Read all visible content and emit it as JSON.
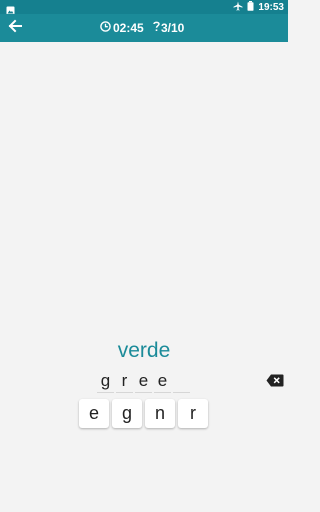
{
  "status_bar": {
    "time": "19:53",
    "left_icon": "image-notification-icon",
    "icons": [
      "airplane-icon",
      "battery-icon"
    ]
  },
  "app_bar": {
    "back_icon": "arrow-left-icon",
    "timer_icon": "clock-icon",
    "timer": "02:45",
    "progress_icon": "question-icon",
    "progress": "3/10"
  },
  "quiz": {
    "word": "verde",
    "answer_slots": [
      "g",
      "r",
      "e",
      "e",
      ""
    ],
    "letter_keys": [
      "e",
      "g",
      "n",
      "r"
    ],
    "backspace_icon": "backspace-icon"
  },
  "colors": {
    "accent": "#1b8b99",
    "status_bar": "#15808f",
    "background": "#f3f3f3"
  }
}
